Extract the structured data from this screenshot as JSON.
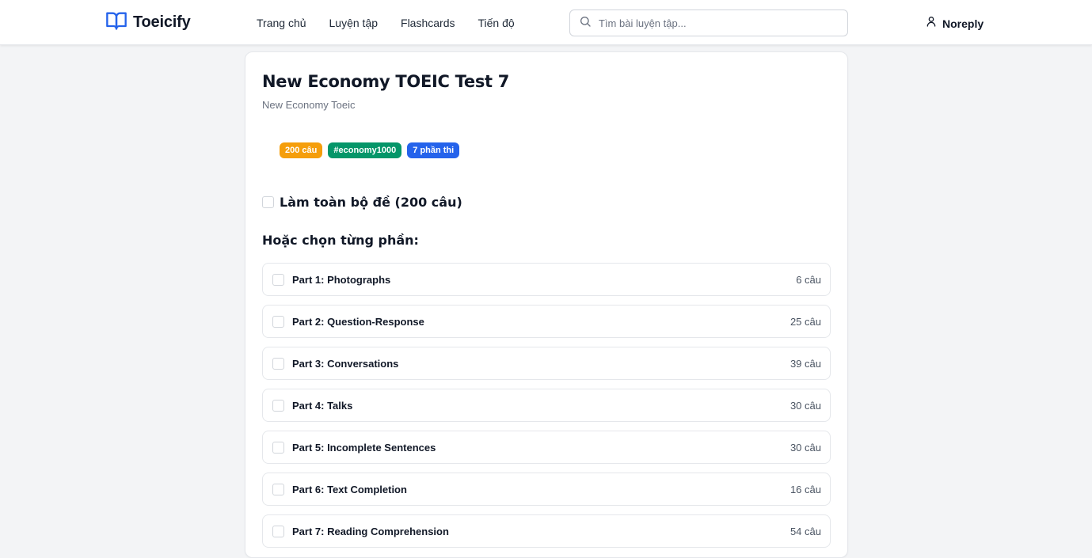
{
  "header": {
    "brand": "Toeicify",
    "nav": [
      {
        "label": "Trang chủ"
      },
      {
        "label": "Luyện tập"
      },
      {
        "label": "Flashcards"
      },
      {
        "label": "Tiến độ"
      }
    ],
    "search_placeholder": "Tìm bài luyện tập...",
    "search_value": "",
    "user_name": "Noreply"
  },
  "test": {
    "title": "New Economy TOEIC Test 7",
    "subtitle": "New Economy Toeic",
    "badges": [
      {
        "label": "200 câu",
        "color": "#f59e0b"
      },
      {
        "label": "#economy1000",
        "color": "#059669"
      },
      {
        "label": "7 phần thi",
        "color": "#2563eb"
      }
    ],
    "full_test_label": "Làm toàn bộ đề (200 câu)",
    "or_choose_label": "Hoặc chọn từng phần:",
    "parts": [
      {
        "label": "Part 1: Photographs",
        "count": "6 câu"
      },
      {
        "label": "Part 2: Question-Response",
        "count": "25 câu"
      },
      {
        "label": "Part 3: Conversations",
        "count": "39 câu"
      },
      {
        "label": "Part 4: Talks",
        "count": "30 câu"
      },
      {
        "label": "Part 5: Incomplete Sentences",
        "count": "30 câu"
      },
      {
        "label": "Part 6: Text Completion",
        "count": "16 câu"
      },
      {
        "label": "Part 7: Reading Comprehension",
        "count": "54 câu"
      }
    ]
  },
  "colors": {
    "brand_blue": "#2563eb",
    "page_bg": "#f3f4f6"
  }
}
